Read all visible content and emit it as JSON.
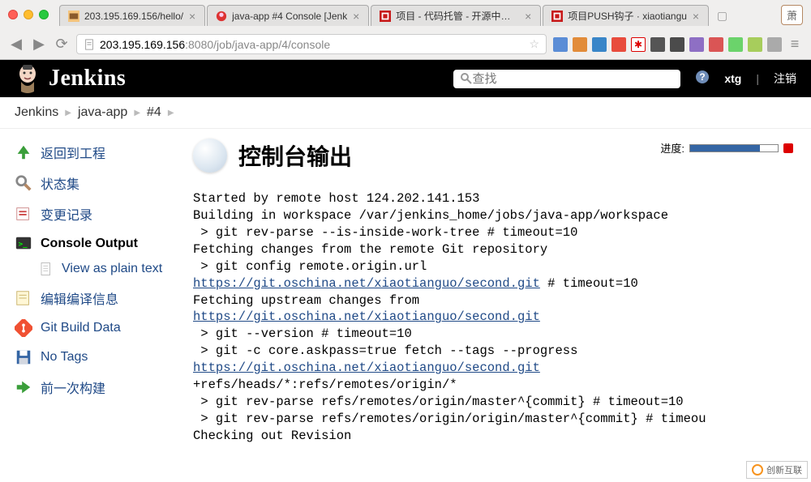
{
  "browser": {
    "tabs": [
      {
        "label": "203.195.169.156/hello/"
      },
      {
        "label": "java-app #4 Console [Jenk"
      },
      {
        "label": "项目 - 代码托管 - 开源中国社"
      },
      {
        "label": "项目PUSH钩子 · xiaotiangu"
      }
    ],
    "user_chip": "萧",
    "url_host": "203.195.169.156",
    "url_port": ":8080",
    "url_path": "/job/java-app/4/console"
  },
  "header": {
    "title": "Jenkins",
    "search_placeholder": "查找",
    "user": "xtg",
    "logout": "注销"
  },
  "crumbs": [
    "Jenkins",
    "java-app",
    "#4"
  ],
  "sidebar": {
    "back": "返回到工程",
    "status": "状态集",
    "changes": "变更记录",
    "console": "Console Output",
    "view_plain": "View as plain text",
    "edit_build": "编辑编译信息",
    "git_data": "Git Build Data",
    "no_tags": "No Tags",
    "prev_build": "前一次构建"
  },
  "content": {
    "progress_label": "进度:",
    "title": "控制台输出",
    "lines": [
      {
        "t": "Started by remote host 124.202.141.153"
      },
      {
        "t": "Building in workspace /var/jenkins_home/jobs/java-app/workspace"
      },
      {
        "t": " > git rev-parse --is-inside-work-tree # timeout=10"
      },
      {
        "t": "Fetching changes from the remote Git repository"
      },
      {
        "t": " > git config remote.origin.url "
      },
      {
        "link": "https://git.oschina.net/xiaotianguo/second.git",
        "tail": " # timeout=10"
      },
      {
        "t": "Fetching upstream changes from "
      },
      {
        "link": "https://git.oschina.net/xiaotianguo/second.git"
      },
      {
        "t": " > git --version # timeout=10"
      },
      {
        "t": " > git -c core.askpass=true fetch --tags --progress "
      },
      {
        "link": "https://git.oschina.net/xiaotianguo/second.git",
        "tail": " +refs/heads/*:refs/remotes/origin/*"
      },
      {
        "t": " > git rev-parse refs/remotes/origin/master^{commit} # timeout=10"
      },
      {
        "t": " > git rev-parse refs/remotes/origin/origin/master^{commit} # timeou"
      },
      {
        "t": "Checking out Revision"
      }
    ]
  },
  "watermark": "创新互联"
}
